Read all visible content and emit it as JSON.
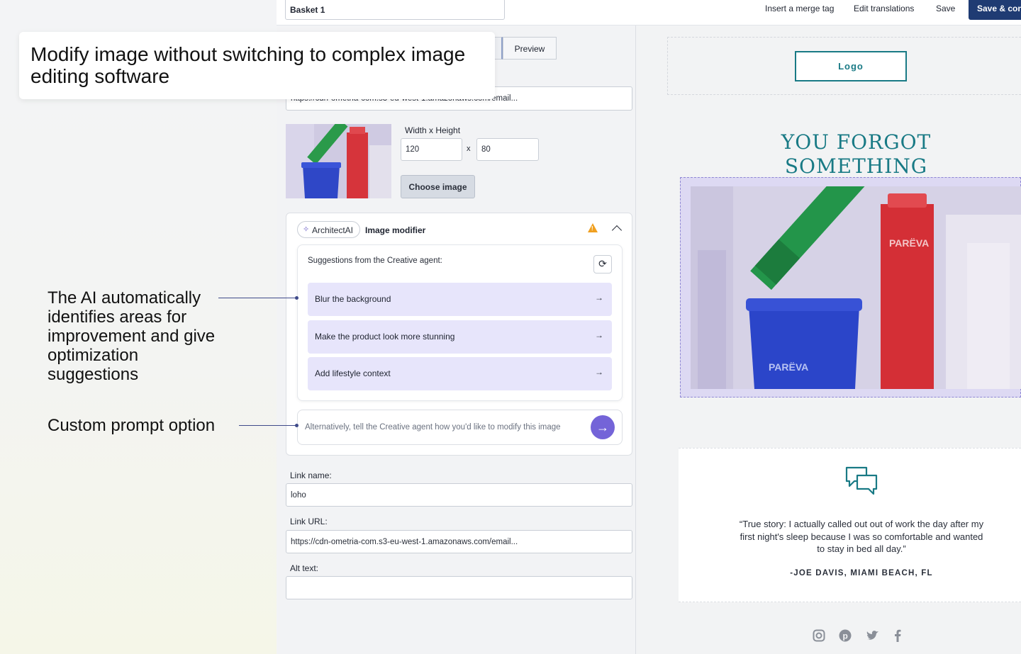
{
  "topbar": {
    "basket_name": "Basket 1",
    "insert_merge_tag": "Insert a merge tag",
    "edit_translations": "Edit translations",
    "save": "Save",
    "save_continue": "Save & cont"
  },
  "callout": {
    "headline": "Modify image without switching to complex image editing software"
  },
  "annotations": {
    "ai_suggestions": "The AI automatically identifies areas for improvement and give optimization suggestions",
    "custom_prompt": "Custom prompt option"
  },
  "editor": {
    "tab_preview": "Preview",
    "image_url": "https://cdn-ometria-com.s3-eu-west-1.amazonaws.com/email...",
    "size_label": "Width x Height",
    "width": "120",
    "height": "80",
    "size_separator": "x",
    "choose_image": "Choose image",
    "ai": {
      "badge": "ArchitectAI",
      "title": "Image modifier",
      "suggestions_heading": "Suggestions from the Creative agent:",
      "suggestions": [
        {
          "label": "Blur the background"
        },
        {
          "label": "Make the product look more stunning"
        },
        {
          "label": "Add lifestyle context"
        }
      ],
      "prompt_placeholder": "Alternatively, tell the Creative agent how you'd like to  modify this image"
    },
    "link_name_label": "Link name:",
    "link_name_value": "loho",
    "link_url_label": "Link URL:",
    "link_url_value": "https://cdn-ometria-com.s3-eu-west-1.amazonaws.com/email...",
    "alt_text_label": "Alt text:",
    "alt_text_value": ""
  },
  "preview": {
    "logo": "Logo",
    "headline": "YOU FORGOT SOMETHING",
    "brand_text": "PARËVA",
    "quote": "“True story: I actually called out out of work the day after my first night's sleep because I was so comfortable and wanted to stay in bed all day.”",
    "quote_author": "-JOE DAVIS, MIAMI BEACH, FL",
    "social_icons": [
      "instagram-icon",
      "pinterest-icon",
      "twitter-icon",
      "facebook-icon"
    ]
  },
  "colors": {
    "accent_teal": "#197a85",
    "ai_purple": "#7464d8",
    "suggestion_bg": "#e7e5fb",
    "primary_navy": "#1f3b73"
  }
}
